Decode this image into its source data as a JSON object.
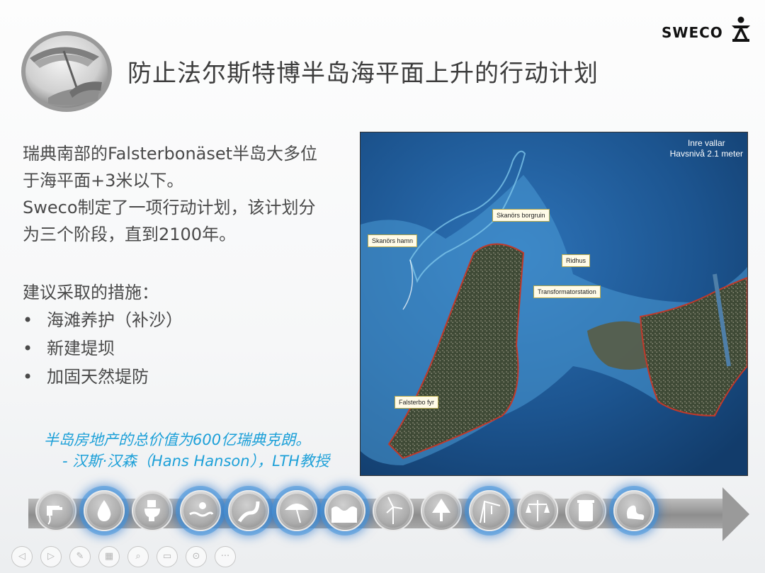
{
  "slide": {
    "title": "防止法尔斯特博半岛海平面上升的行动计划",
    "logo_text": "SWECO",
    "intro_lines": [
      "瑞典南部的Falsterbonäset半岛大多位",
      "于海平面+3米以下。",
      "Sweco制定了一项行动计划，该计划分",
      "为三个阶段，直到2100年。"
    ],
    "measures_heading": "建议采取的措施：",
    "measures": [
      "海滩养护（补沙）",
      "新建堤坝",
      "加固天然堤防"
    ],
    "bullet": "•",
    "quote_line1": "半岛房地产的总价值为600亿瑞典克朗。",
    "quote_line2": "- 汉斯·汉森（Hans Hanson），LTH教授"
  },
  "map": {
    "legend_line1": "Inre vallar",
    "legend_line2": "Havsnivå 2.1 meter",
    "labels": {
      "skanors_hamn": "Skanörs hamn",
      "skanors_borgruin": "Skanörs borgruin",
      "ridhus": "Ridhus",
      "transformatorstation": "Transformatorstation",
      "falsterbo_fyr": "Falsterbo fyr"
    }
  },
  "icon_strip": {
    "icons": [
      {
        "name": "faucet-icon",
        "highlighted": false
      },
      {
        "name": "water-drop-icon",
        "highlighted": true
      },
      {
        "name": "toilet-icon",
        "highlighted": false
      },
      {
        "name": "pool-icon",
        "highlighted": true
      },
      {
        "name": "river-icon",
        "highlighted": true
      },
      {
        "name": "umbrella-icon",
        "highlighted": true
      },
      {
        "name": "waves-icon",
        "highlighted": true
      },
      {
        "name": "wind-turbine-icon",
        "highlighted": false
      },
      {
        "name": "tree-icon",
        "highlighted": false
      },
      {
        "name": "crane-icon",
        "highlighted": true
      },
      {
        "name": "scales-icon",
        "highlighted": false
      },
      {
        "name": "bin-icon",
        "highlighted": false
      },
      {
        "name": "swan-icon",
        "highlighted": true
      }
    ]
  },
  "toolbar": {
    "buttons": [
      {
        "name": "prev-slide-button",
        "glyph": "◁"
      },
      {
        "name": "next-slide-button",
        "glyph": "▷"
      },
      {
        "name": "pen-button",
        "glyph": "✎"
      },
      {
        "name": "slides-button",
        "glyph": "▦"
      },
      {
        "name": "zoom-button",
        "glyph": "⌕"
      },
      {
        "name": "subtitles-button",
        "glyph": "▭"
      },
      {
        "name": "laser-button",
        "glyph": "⊙"
      },
      {
        "name": "more-button",
        "glyph": "···"
      }
    ]
  },
  "colors": {
    "title": "#3d3d3d",
    "body": "#4a4a4a",
    "quote": "#1da0d8",
    "sea": "#1a4f8f",
    "highlight_glow": "#1e6ec8"
  }
}
